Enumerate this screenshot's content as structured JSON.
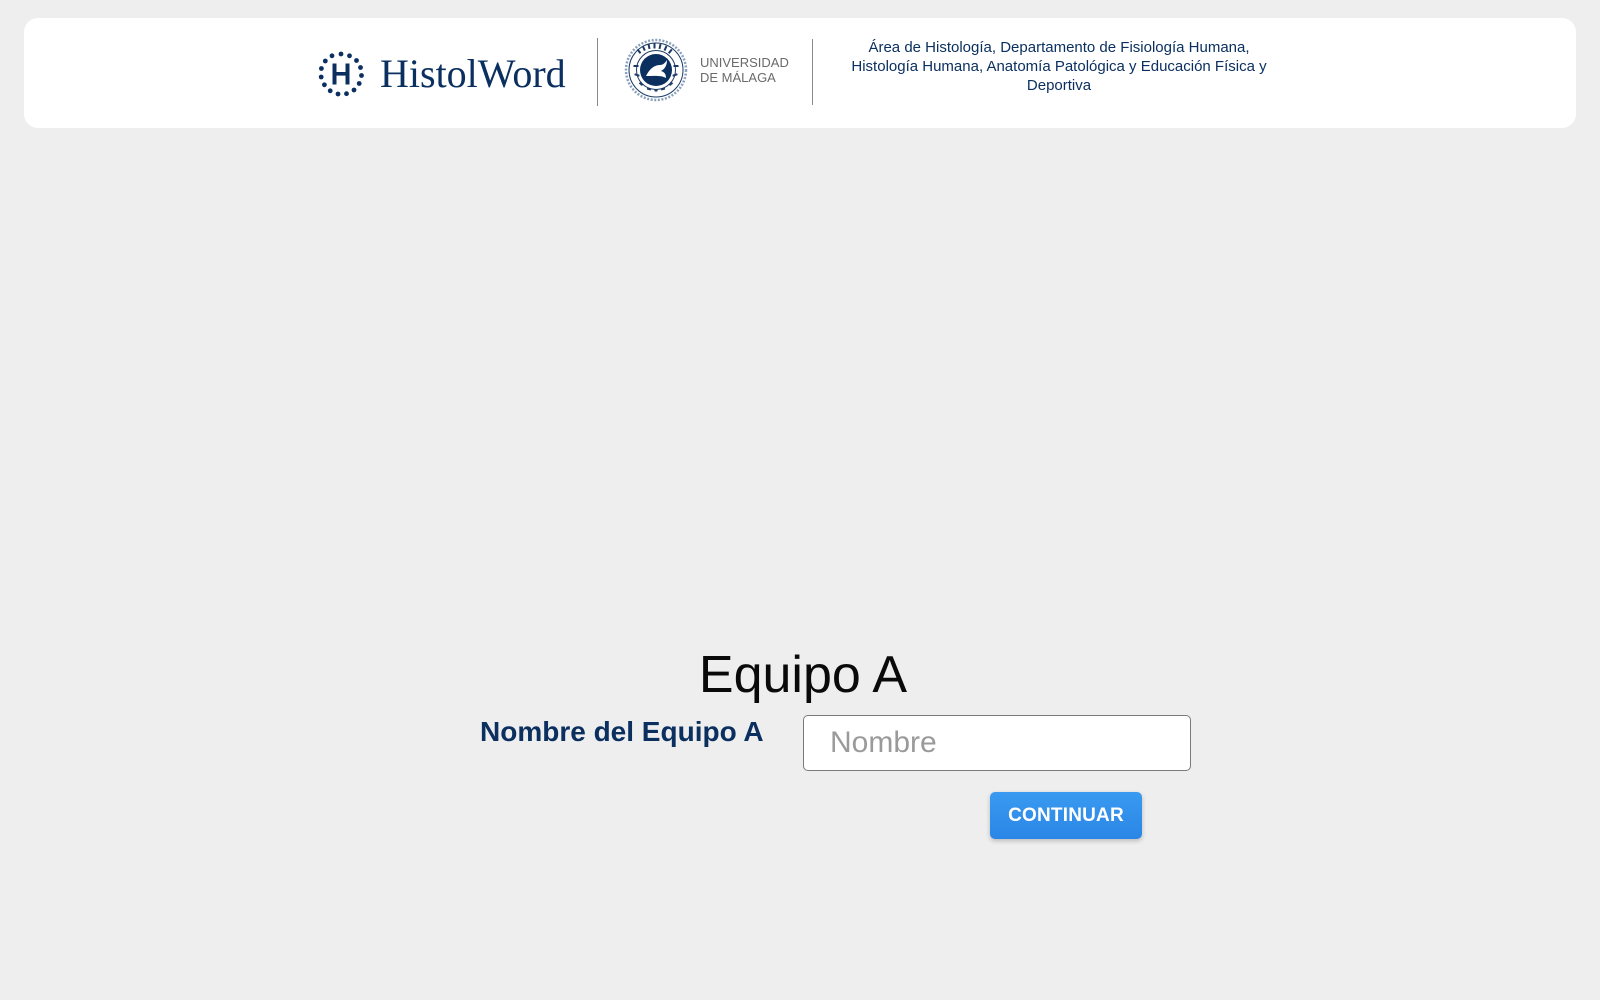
{
  "header": {
    "brand_name": "HistolWord",
    "brand_icon": "h-dotted-circle-icon",
    "university_line1": "UNIVERSIDAD",
    "university_line2": "DE MÁLAGA",
    "university_seal": "university-seal-icon",
    "department": "Área de Histología, Departamento de Fisiología Humana, Histología Humana, Anatomía Patológica y Educación Física y Deportiva"
  },
  "main": {
    "title": "Equipo A",
    "name_label": "Nombre del Equipo A",
    "name_input_value": "",
    "name_input_placeholder": "Nombre",
    "continue_label": "CONTINUAR"
  },
  "colors": {
    "brand": "#0b3060",
    "accent": "#2a86e6",
    "background": "#eeeeee"
  }
}
